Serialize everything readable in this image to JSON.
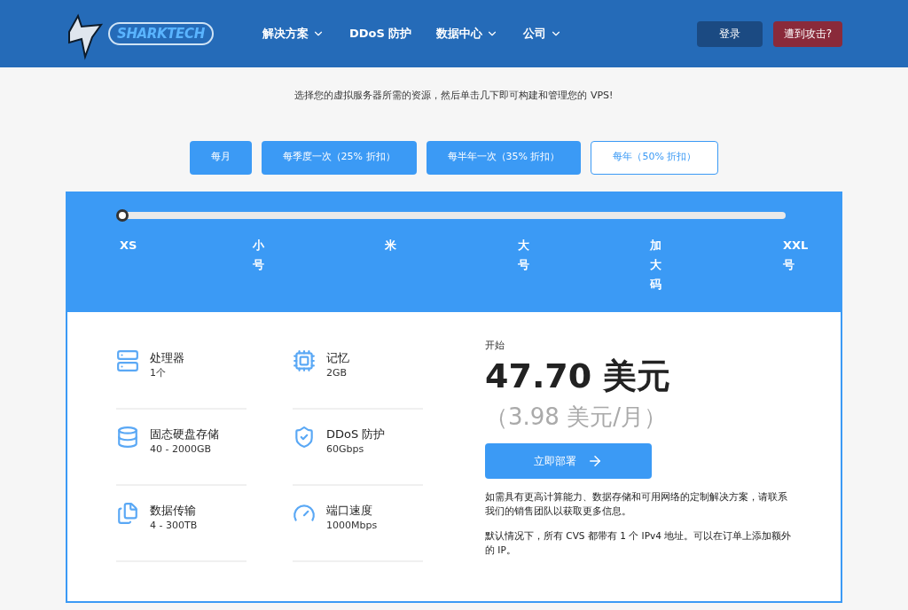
{
  "header": {
    "logo": "SHARKTECH",
    "nav": [
      {
        "label": "解决方案",
        "has_menu": true
      },
      {
        "label": "DDoS 防护",
        "has_menu": false
      },
      {
        "label": "数据中心",
        "has_menu": true
      },
      {
        "label": "公司",
        "has_menu": true
      }
    ],
    "buttons": [
      {
        "label": "登录",
        "kind": "login"
      },
      {
        "label": "遭到攻击?",
        "kind": "alert"
      }
    ]
  },
  "subtitle": "选择您的虚拟服务器所需的资源，然后单击几下即可构建和管理您的 VPS!",
  "billing": [
    {
      "label": "每月",
      "selected": false
    },
    {
      "label": "每季度一次（25% 折扣）",
      "selected": false
    },
    {
      "label": "每半年一次（35% 折扣）",
      "selected": false
    },
    {
      "label": "每年（50% 折扣）",
      "selected": true
    }
  ],
  "size_slider": {
    "level": 0,
    "stops": [
      "XS",
      "小号",
      "米",
      "大号",
      "加大码",
      "XXL号"
    ]
  },
  "specs": [
    {
      "kind": "processor",
      "name": "处理器",
      "value": "1个"
    },
    {
      "kind": "memory",
      "name": "记忆",
      "value": "2GB"
    },
    {
      "kind": "storage",
      "name": "固态硬盘存储",
      "value": "40 - 2000GB"
    },
    {
      "kind": "ddos",
      "name": "DDoS 防护",
      "value": "60Gbps"
    },
    {
      "kind": "transfer",
      "name": "数据传输",
      "value": "4 - 300TB"
    },
    {
      "kind": "port",
      "name": "端口速度",
      "value": "1000Mbps"
    }
  ],
  "pricing": {
    "caption": "开始",
    "price": "47.70 美元",
    "monthly": "（3.98 美元/月）",
    "button": "立即部署",
    "notes": [
      "如需具有更高计算能力、数据存储和可用网络的定制解决方案，请联系我们的销售团队以获取更多信息。",
      "默认情况下，所有 CVS 都带有 1 个 IPv4 地址。可以在订单上添加额外的 IP。"
    ]
  }
}
